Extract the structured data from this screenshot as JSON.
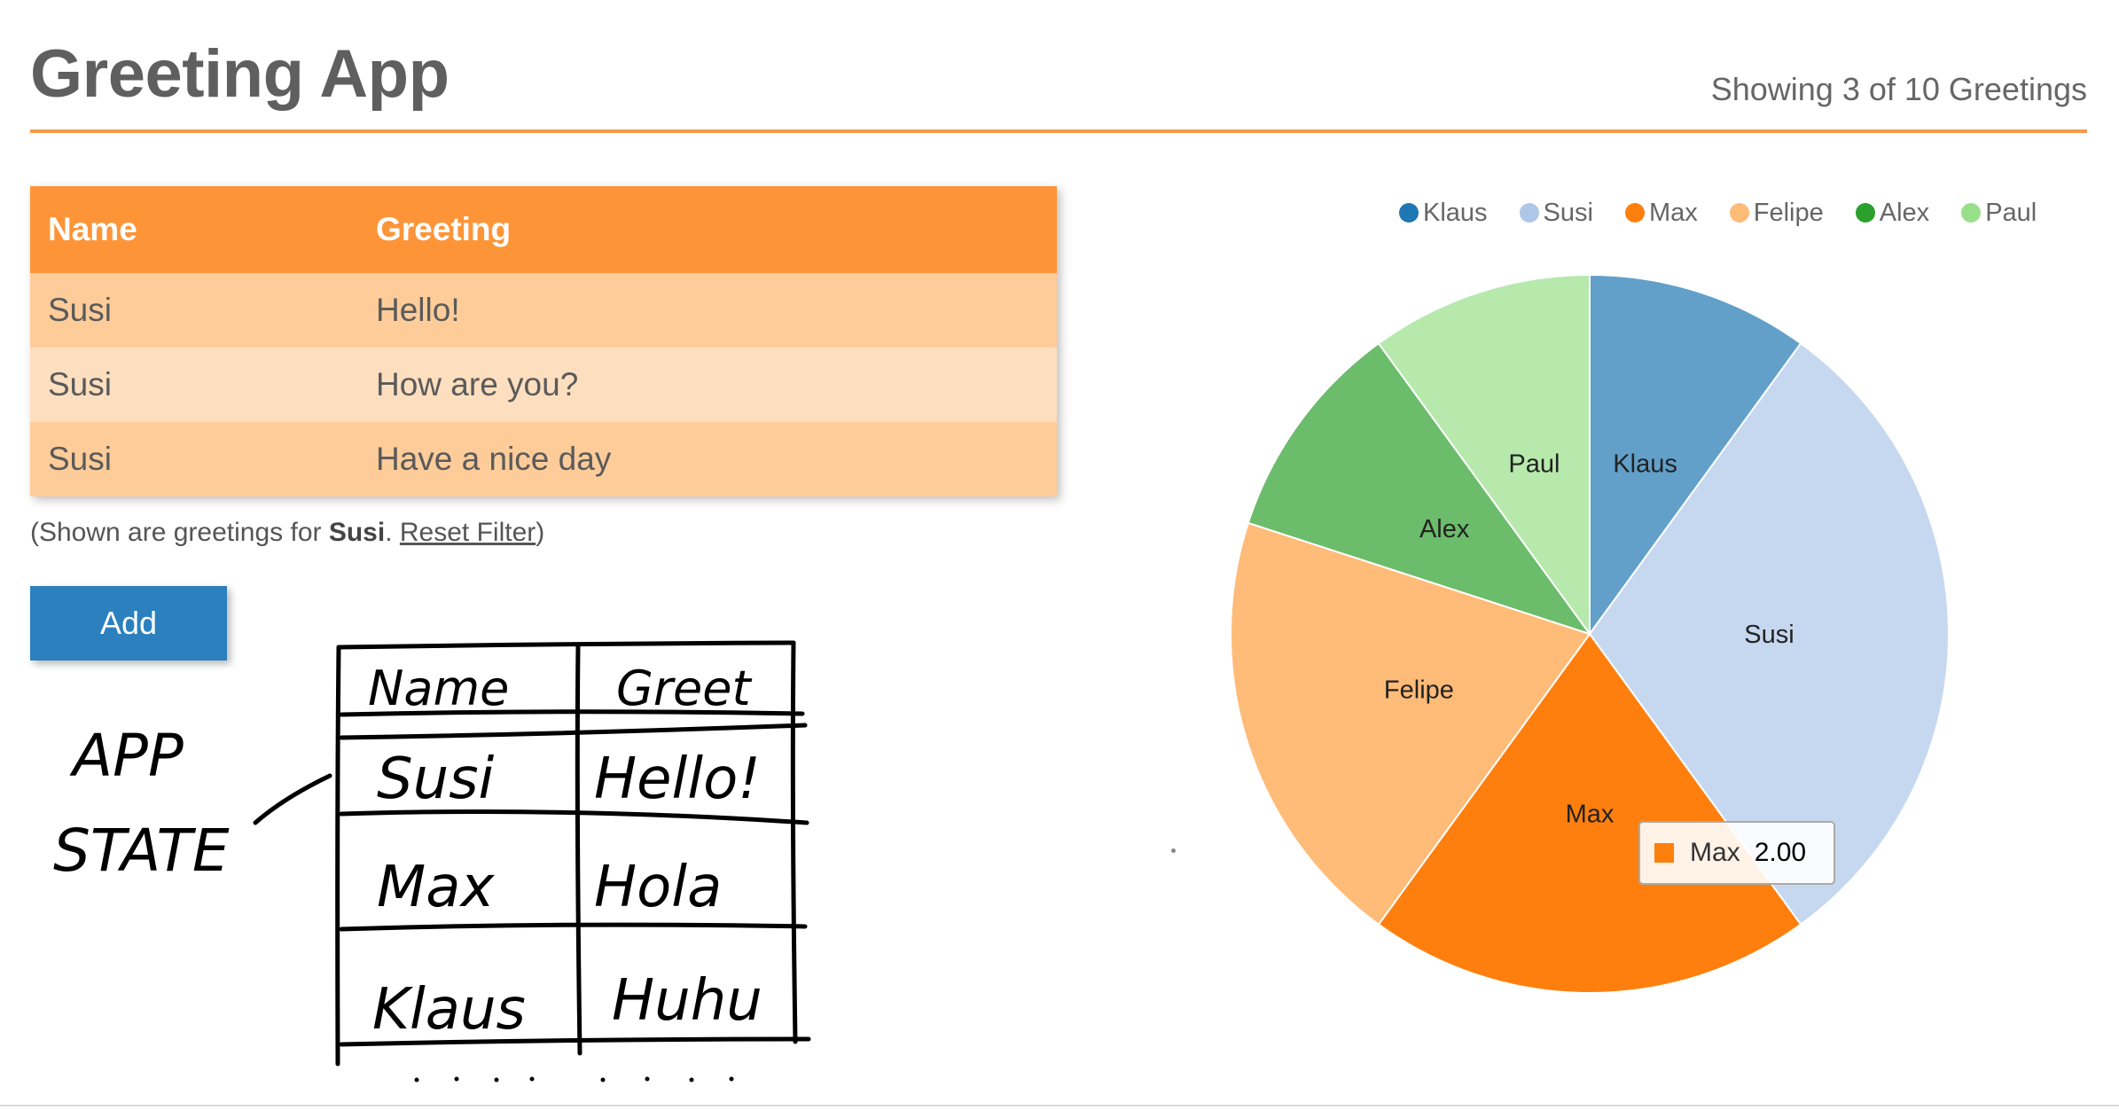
{
  "header": {
    "title": "Greeting App",
    "showing": "Showing 3 of 10 Greetings"
  },
  "table": {
    "columns": [
      "Name",
      "Greeting"
    ],
    "rows": [
      {
        "name": "Susi",
        "greeting": "Hello!"
      },
      {
        "name": "Susi",
        "greeting": "How are you?"
      },
      {
        "name": "Susi",
        "greeting": "Have a nice day"
      }
    ]
  },
  "filter": {
    "prefix": "(Shown are greetings for ",
    "name": "Susi",
    "separator": ". ",
    "reset_label": "Reset Filter",
    "suffix": ")"
  },
  "add_button": "Add",
  "sketch": {
    "app_state_line1": "APP",
    "app_state_line2": "STATE",
    "headers": [
      "Name",
      "Greet"
    ],
    "rows": [
      [
        "Susi",
        "Hello!"
      ],
      [
        "Max",
        "Hola"
      ],
      [
        "Klaus",
        "Huhu"
      ]
    ]
  },
  "chart_data": {
    "type": "pie",
    "labels": [
      "Klaus",
      "Susi",
      "Max",
      "Felipe",
      "Alex",
      "Paul"
    ],
    "values": [
      1,
      3,
      2,
      2,
      1,
      1
    ],
    "colors": [
      "#1f77b4",
      "#aec7e8",
      "#ff7f0e",
      "#ffbb78",
      "#2ca02c",
      "#98df8a"
    ],
    "legend_position": "top-right",
    "tooltip": {
      "label": "Max",
      "value": "2.00",
      "color": "#ff7f0e"
    }
  }
}
